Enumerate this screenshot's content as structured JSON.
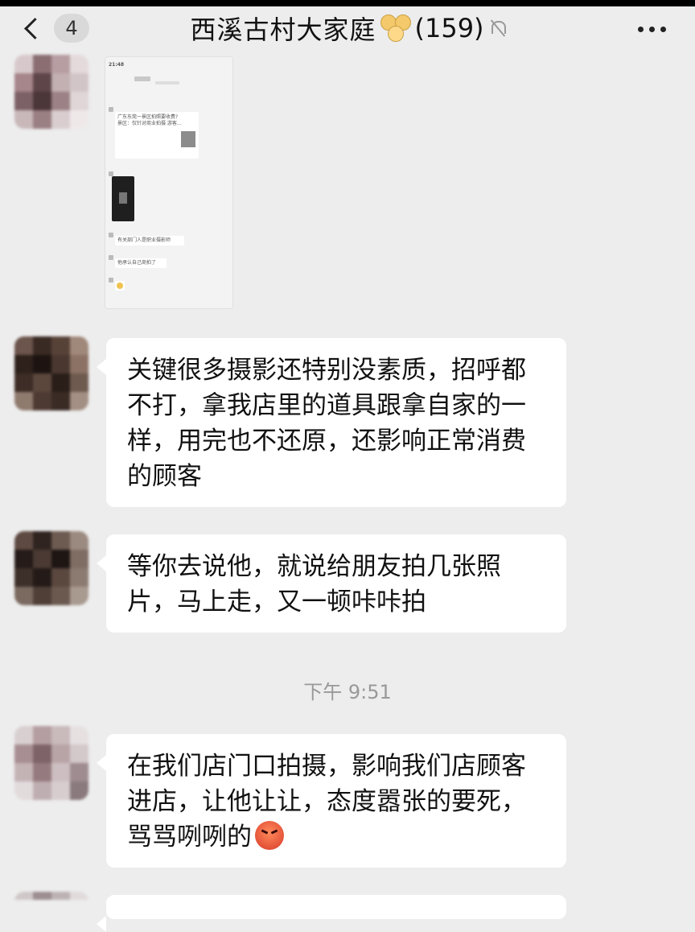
{
  "header": {
    "unread_count": "4",
    "title": "西溪古村大家庭",
    "member_count": "(159)"
  },
  "icons": {
    "back": "chevron-left-icon",
    "mute": "bell-slash-icon",
    "more": "more-dots-icon",
    "title_emoji": "family-emoji-icon",
    "angry": "angry-face-emoji-icon"
  },
  "messages": [
    {
      "type": "image",
      "content": "chat-screenshot"
    },
    {
      "type": "text",
      "text": "关键很多摄影还特别没素质，招呼都不打，拿我店里的道具跟拿自家的一样，用完也不还原，还影响正常消费的顾客"
    },
    {
      "type": "text",
      "text": "等你去说他，就说给朋友拍几张照片，马上走，又一顿咔咔拍"
    },
    {
      "type": "time",
      "text": "下午 9:51"
    },
    {
      "type": "text",
      "text": "在我们店门口拍摄，影响我们店顾客进店，让他让让，态度嚣张的要死，骂骂咧咧的"
    }
  ],
  "screenshot_thumb": {
    "time": "21:48",
    "card_title": "广东东莞一景区拍照要收费?景区：仅针对商业拍摄 游客…",
    "line1": "有关部门人是职业摄影师",
    "line2": "他承认自己商拍了"
  },
  "colors": {
    "background": "#ededed",
    "bubble": "#ffffff",
    "timestamp": "#999999"
  }
}
